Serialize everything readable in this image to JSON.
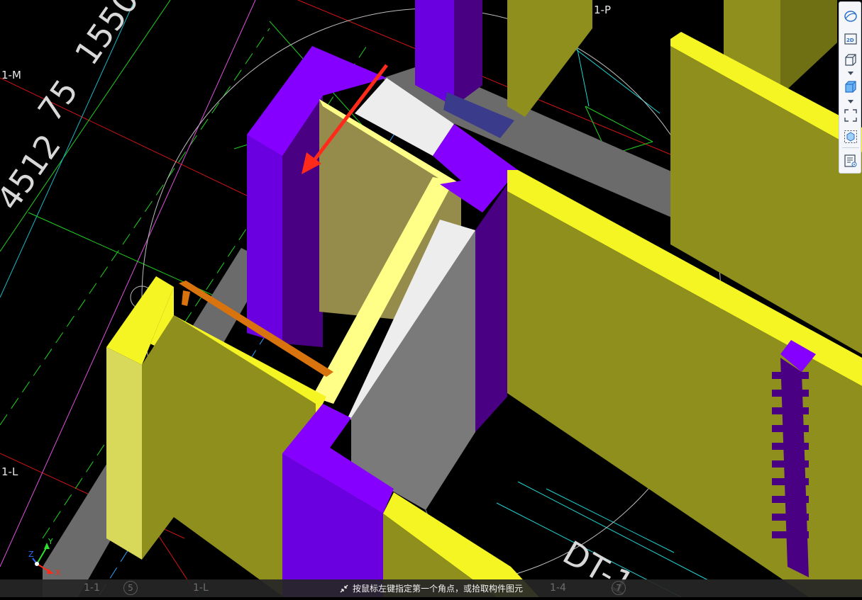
{
  "viewport": {
    "axis_labels": [
      "1-M",
      "1-L",
      "1-P"
    ],
    "cad_texts": [
      "1550",
      "75",
      "DT-1"
    ],
    "colors": {
      "wall_yellow": "#f5f524",
      "wall_olive": "#8f8f1e",
      "column_purple": "#8600ff",
      "column_purple_dark": "#4a0082",
      "slab_white": "#ededed",
      "slab_grey": "#7a7a7a",
      "arrow_red": "#ff2a1a",
      "beam_orange": "#d9730d"
    }
  },
  "toolbar": {
    "buttons": [
      {
        "name": "orbit-icon",
        "label": ""
      },
      {
        "name": "2d-view-icon",
        "label": "2D"
      },
      {
        "name": "3d-view-icon",
        "label": ""
      },
      {
        "name": "3d-solid-view-icon",
        "label": ""
      },
      {
        "name": "zoom-extents-icon",
        "label": ""
      },
      {
        "name": "isolate-icon",
        "label": ""
      },
      {
        "name": "display-settings-icon",
        "label": ""
      }
    ]
  },
  "statusbar": {
    "message": "按鼠标左键指定第一个角点，或拾取构件图元",
    "ghost_labels": [
      "1-1",
      "5",
      "1-L",
      "1-4",
      "7"
    ]
  },
  "gizmo": {
    "x": "X",
    "y": "Y",
    "z": "Z"
  }
}
